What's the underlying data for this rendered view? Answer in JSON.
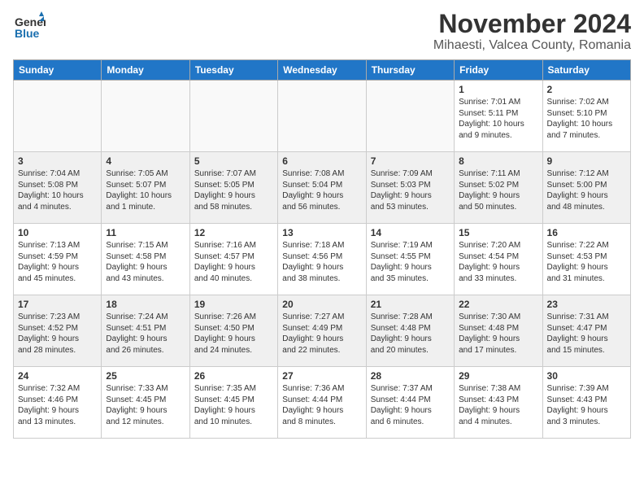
{
  "header": {
    "logo_general": "General",
    "logo_blue": "Blue",
    "month": "November 2024",
    "location": "Mihaesti, Valcea County, Romania"
  },
  "days_of_week": [
    "Sunday",
    "Monday",
    "Tuesday",
    "Wednesday",
    "Thursday",
    "Friday",
    "Saturday"
  ],
  "weeks": [
    [
      {
        "day": "",
        "text": ""
      },
      {
        "day": "",
        "text": ""
      },
      {
        "day": "",
        "text": ""
      },
      {
        "day": "",
        "text": ""
      },
      {
        "day": "",
        "text": ""
      },
      {
        "day": "1",
        "text": "Sunrise: 7:01 AM\nSunset: 5:11 PM\nDaylight: 10 hours\nand 9 minutes."
      },
      {
        "day": "2",
        "text": "Sunrise: 7:02 AM\nSunset: 5:10 PM\nDaylight: 10 hours\nand 7 minutes."
      }
    ],
    [
      {
        "day": "3",
        "text": "Sunrise: 7:04 AM\nSunset: 5:08 PM\nDaylight: 10 hours\nand 4 minutes."
      },
      {
        "day": "4",
        "text": "Sunrise: 7:05 AM\nSunset: 5:07 PM\nDaylight: 10 hours\nand 1 minute."
      },
      {
        "day": "5",
        "text": "Sunrise: 7:07 AM\nSunset: 5:05 PM\nDaylight: 9 hours\nand 58 minutes."
      },
      {
        "day": "6",
        "text": "Sunrise: 7:08 AM\nSunset: 5:04 PM\nDaylight: 9 hours\nand 56 minutes."
      },
      {
        "day": "7",
        "text": "Sunrise: 7:09 AM\nSunset: 5:03 PM\nDaylight: 9 hours\nand 53 minutes."
      },
      {
        "day": "8",
        "text": "Sunrise: 7:11 AM\nSunset: 5:02 PM\nDaylight: 9 hours\nand 50 minutes."
      },
      {
        "day": "9",
        "text": "Sunrise: 7:12 AM\nSunset: 5:00 PM\nDaylight: 9 hours\nand 48 minutes."
      }
    ],
    [
      {
        "day": "10",
        "text": "Sunrise: 7:13 AM\nSunset: 4:59 PM\nDaylight: 9 hours\nand 45 minutes."
      },
      {
        "day": "11",
        "text": "Sunrise: 7:15 AM\nSunset: 4:58 PM\nDaylight: 9 hours\nand 43 minutes."
      },
      {
        "day": "12",
        "text": "Sunrise: 7:16 AM\nSunset: 4:57 PM\nDaylight: 9 hours\nand 40 minutes."
      },
      {
        "day": "13",
        "text": "Sunrise: 7:18 AM\nSunset: 4:56 PM\nDaylight: 9 hours\nand 38 minutes."
      },
      {
        "day": "14",
        "text": "Sunrise: 7:19 AM\nSunset: 4:55 PM\nDaylight: 9 hours\nand 35 minutes."
      },
      {
        "day": "15",
        "text": "Sunrise: 7:20 AM\nSunset: 4:54 PM\nDaylight: 9 hours\nand 33 minutes."
      },
      {
        "day": "16",
        "text": "Sunrise: 7:22 AM\nSunset: 4:53 PM\nDaylight: 9 hours\nand 31 minutes."
      }
    ],
    [
      {
        "day": "17",
        "text": "Sunrise: 7:23 AM\nSunset: 4:52 PM\nDaylight: 9 hours\nand 28 minutes."
      },
      {
        "day": "18",
        "text": "Sunrise: 7:24 AM\nSunset: 4:51 PM\nDaylight: 9 hours\nand 26 minutes."
      },
      {
        "day": "19",
        "text": "Sunrise: 7:26 AM\nSunset: 4:50 PM\nDaylight: 9 hours\nand 24 minutes."
      },
      {
        "day": "20",
        "text": "Sunrise: 7:27 AM\nSunset: 4:49 PM\nDaylight: 9 hours\nand 22 minutes."
      },
      {
        "day": "21",
        "text": "Sunrise: 7:28 AM\nSunset: 4:48 PM\nDaylight: 9 hours\nand 20 minutes."
      },
      {
        "day": "22",
        "text": "Sunrise: 7:30 AM\nSunset: 4:48 PM\nDaylight: 9 hours\nand 17 minutes."
      },
      {
        "day": "23",
        "text": "Sunrise: 7:31 AM\nSunset: 4:47 PM\nDaylight: 9 hours\nand 15 minutes."
      }
    ],
    [
      {
        "day": "24",
        "text": "Sunrise: 7:32 AM\nSunset: 4:46 PM\nDaylight: 9 hours\nand 13 minutes."
      },
      {
        "day": "25",
        "text": "Sunrise: 7:33 AM\nSunset: 4:45 PM\nDaylight: 9 hours\nand 12 minutes."
      },
      {
        "day": "26",
        "text": "Sunrise: 7:35 AM\nSunset: 4:45 PM\nDaylight: 9 hours\nand 10 minutes."
      },
      {
        "day": "27",
        "text": "Sunrise: 7:36 AM\nSunset: 4:44 PM\nDaylight: 9 hours\nand 8 minutes."
      },
      {
        "day": "28",
        "text": "Sunrise: 7:37 AM\nSunset: 4:44 PM\nDaylight: 9 hours\nand 6 minutes."
      },
      {
        "day": "29",
        "text": "Sunrise: 7:38 AM\nSunset: 4:43 PM\nDaylight: 9 hours\nand 4 minutes."
      },
      {
        "day": "30",
        "text": "Sunrise: 7:39 AM\nSunset: 4:43 PM\nDaylight: 9 hours\nand 3 minutes."
      }
    ]
  ]
}
